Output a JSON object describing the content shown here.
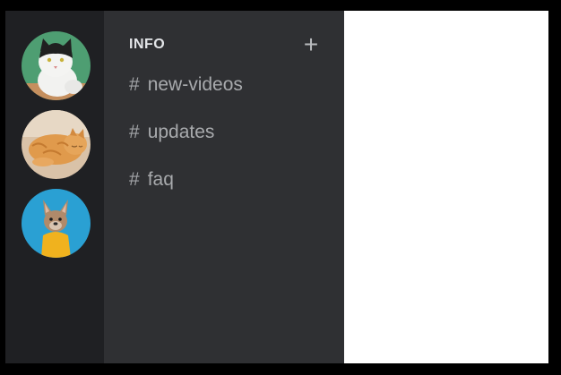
{
  "servers": [
    {
      "name": "cat-on-green",
      "icon": "black-white-cat-avatar-icon",
      "bg": "#4e9e72"
    },
    {
      "name": "sleeping-orange-cat",
      "icon": "orange-cat-avatar-icon",
      "bg": "#c9a27a"
    },
    {
      "name": "dog-on-blue",
      "icon": "french-bulldog-avatar-icon",
      "bg": "#2aa0d3"
    }
  ],
  "category": {
    "title": "INFO",
    "add_label": "+"
  },
  "channels": [
    {
      "hash": "#",
      "name": "new-videos"
    },
    {
      "hash": "#",
      "name": "updates"
    },
    {
      "hash": "#",
      "name": "faq"
    }
  ],
  "colors": {
    "rail_bg": "#1f2023",
    "panel_bg": "#2f3033",
    "content_bg": "#ffffff",
    "channel_text": "#a8aaad"
  }
}
